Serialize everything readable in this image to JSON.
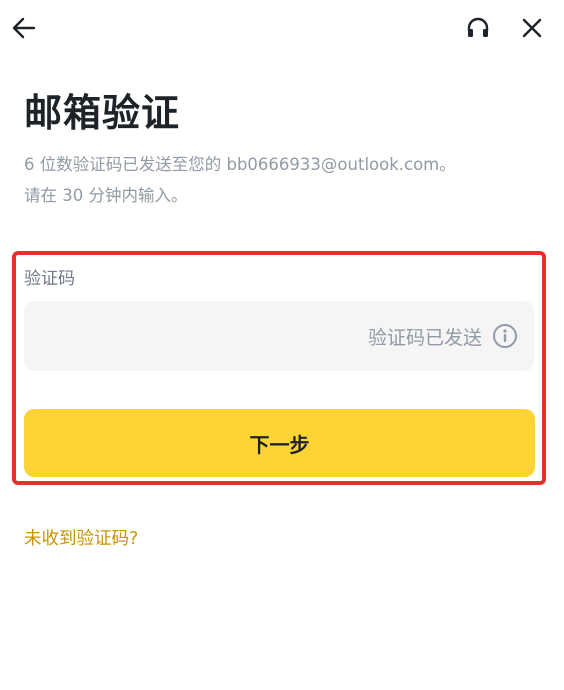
{
  "header": {
    "back_icon": "arrow-left-icon",
    "support_icon": "headset-icon",
    "close_icon": "close-icon"
  },
  "page": {
    "title": "邮箱验证",
    "description_line1": "6 位数验证码已发送至您的 bb0666933@outlook.com。",
    "description_line2": "请在 30 分钟内输入。"
  },
  "form": {
    "code_label": "验证码",
    "code_value": "",
    "sent_status": "验证码已发送",
    "info_icon": "info-circle-icon",
    "next_label": "下一步",
    "highlight_color": "#e5302b",
    "button_color": "#fcd535"
  },
  "links": {
    "resend": "未收到验证码?"
  }
}
